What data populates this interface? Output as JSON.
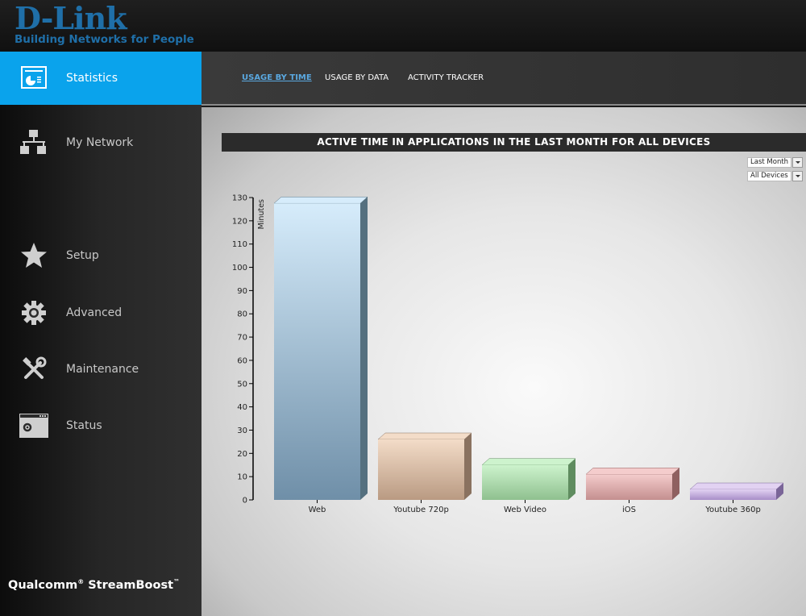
{
  "header": {
    "logo_main": "D-Link",
    "logo_tagline": "Building Networks for People"
  },
  "sidebar": {
    "items": [
      {
        "label": "Statistics",
        "icon": "statistics-icon",
        "active": true
      },
      {
        "label": "My Network",
        "icon": "network-icon",
        "active": false
      },
      {
        "label": "Setup",
        "icon": "star-icon",
        "active": false
      },
      {
        "label": "Advanced",
        "icon": "gear-icon",
        "active": false
      },
      {
        "label": "Maintenance",
        "icon": "tools-icon",
        "active": false
      },
      {
        "label": "Status",
        "icon": "status-window-icon",
        "active": false
      }
    ],
    "brand": "Qualcomm",
    "brand_reg": "®",
    "brand_product": " StreamBoost",
    "brand_tm": "™"
  },
  "tabs": [
    {
      "label": "USAGE BY TIME",
      "active": true
    },
    {
      "label": "USAGE BY DATA",
      "active": false
    },
    {
      "label": "ACTIVITY TRACKER",
      "active": false
    }
  ],
  "filters": {
    "period": "Last Month",
    "devices": "All Devices"
  },
  "colors": {
    "accent": "#0aa3ec",
    "active_tab": "#5aa8e0"
  },
  "chart_data": {
    "type": "bar",
    "title": "ACTIVE TIME IN APPLICATIONS IN THE LAST MONTH FOR ALL DEVICES",
    "xlabel": "",
    "ylabel": "Minutes",
    "ylim": [
      0,
      130
    ],
    "yticks": [
      0,
      10,
      20,
      30,
      40,
      50,
      60,
      70,
      80,
      90,
      100,
      110,
      120,
      130
    ],
    "categories": [
      "Web",
      "Youtube 720p",
      "Web Video",
      "iOS",
      "Youtube 360p"
    ],
    "values": [
      127.5,
      26,
      15,
      11,
      4.5
    ],
    "bar_colors": [
      {
        "top": "#d6ecfb",
        "bottom": "#6f8fa8",
        "side": "#55707f"
      },
      {
        "top": "#f3dcc8",
        "bottom": "#b99a82",
        "side": "#8a7260"
      },
      {
        "top": "#cdf3cd",
        "bottom": "#8fc08f",
        "side": "#5f8c5f"
      },
      {
        "top": "#f4cccc",
        "bottom": "#c48f8f",
        "side": "#8f6060"
      },
      {
        "top": "#e2d2f2",
        "bottom": "#a88ec8",
        "side": "#7a6598"
      }
    ],
    "grid": false,
    "legend": "none"
  }
}
